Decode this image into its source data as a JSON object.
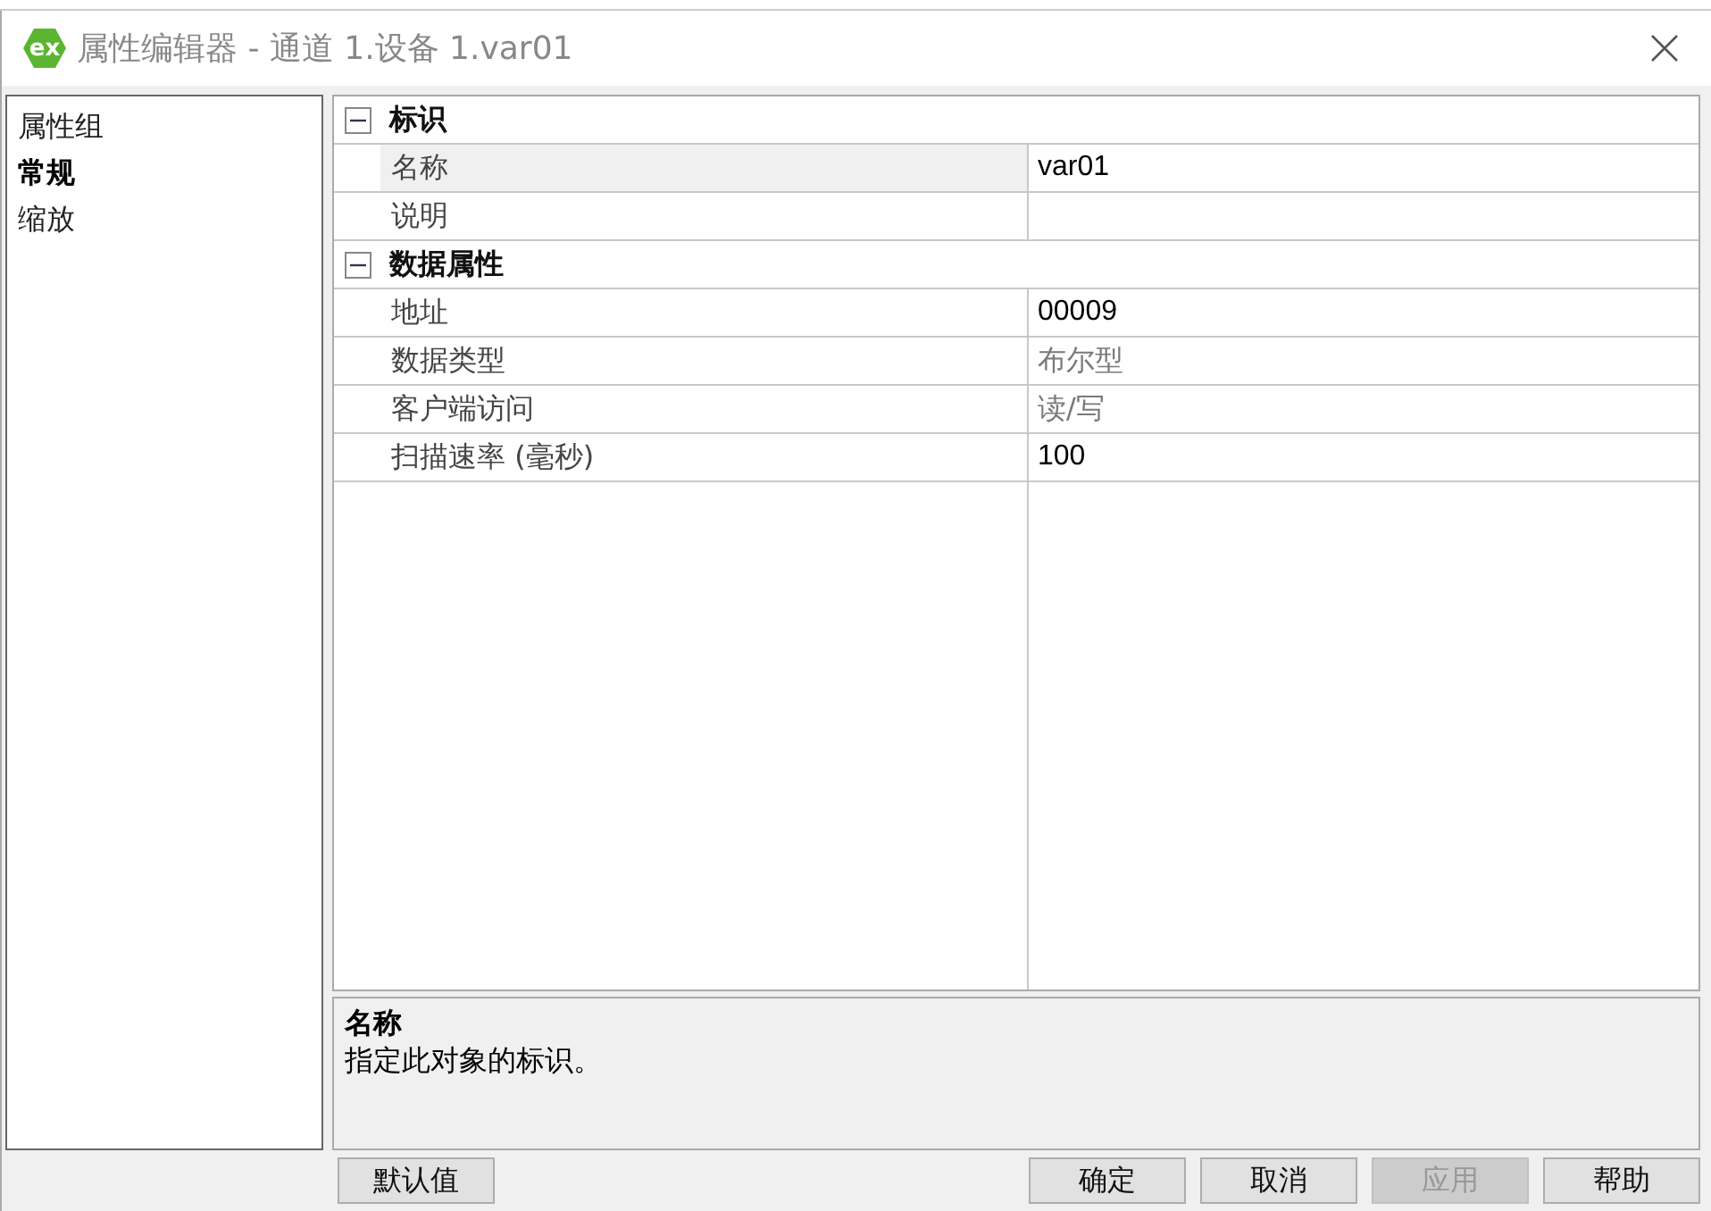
{
  "window": {
    "logo_text": "ex",
    "title": "属性编辑器 - 通道 1.设备 1.var01"
  },
  "sidebar": {
    "items": [
      {
        "label": "属性组",
        "selected": false
      },
      {
        "label": "常规",
        "selected": true
      },
      {
        "label": "缩放",
        "selected": false
      }
    ]
  },
  "property_grid": {
    "groups": [
      {
        "label": "标识",
        "expanded": true,
        "rows": [
          {
            "name": "名称",
            "value": "var01",
            "selected": true,
            "readonly": false
          },
          {
            "name": "说明",
            "selected": false,
            "readonly": false
          }
        ]
      },
      {
        "label": "数据属性",
        "expanded": true,
        "rows": [
          {
            "name": "地址",
            "value": "00009",
            "selected": false,
            "readonly": false
          },
          {
            "name": "数据类型",
            "value": "布尔型",
            "selected": false,
            "readonly": true
          },
          {
            "name": "客户端访问",
            "value": "读/写",
            "selected": false,
            "readonly": true
          },
          {
            "name": "扫描速率 (毫秒)",
            "value": "100",
            "selected": false,
            "readonly": false
          }
        ]
      }
    ]
  },
  "description": {
    "title": "名称",
    "text": "指定此对象的标识。"
  },
  "buttons": [
    {
      "label": "默认值",
      "disabled": false
    },
    {
      "label": "确定",
      "disabled": false
    },
    {
      "label": "取消",
      "disabled": false
    },
    {
      "label": "应用",
      "disabled": true
    },
    {
      "label": "帮助",
      "disabled": false
    }
  ]
}
